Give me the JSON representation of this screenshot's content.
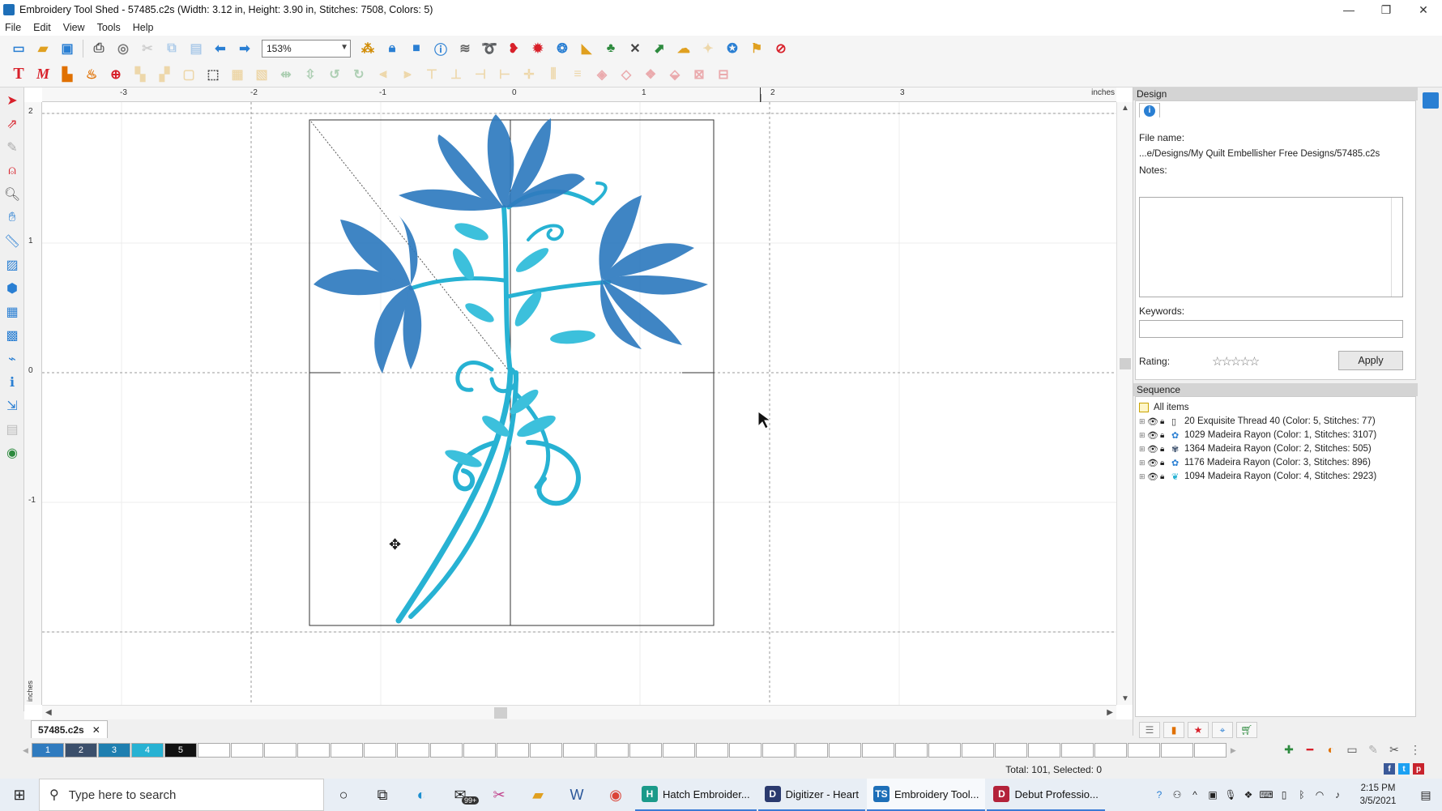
{
  "window": {
    "title": "Embroidery Tool Shed - 57485.c2s (Width: 3.12 in, Height: 3.90 in, Stitches: 7508, Colors: 5)",
    "minimize": "—",
    "restore": "❐",
    "close": "✕"
  },
  "menu": [
    "File",
    "Edit",
    "View",
    "Tools",
    "Help"
  ],
  "toolbar": {
    "zoom_value": "153%",
    "zoom_options": [
      "153%"
    ]
  },
  "ruler": {
    "units": "inches",
    "h_labels": [
      "-3",
      "-2",
      "-1",
      "0",
      "1",
      "2",
      "3"
    ],
    "v_labels": [
      "2",
      "1",
      "0",
      "-1"
    ],
    "v_units": "inches"
  },
  "document_tab": {
    "name": "57485.c2s",
    "close": "✕"
  },
  "color_swatches": [
    {
      "label": "1",
      "color": "#2f7bbf"
    },
    {
      "label": "2",
      "color": "#3b4f6b"
    },
    {
      "label": "3",
      "color": "#1f7fb0"
    },
    {
      "label": "4",
      "color": "#27b2d3"
    },
    {
      "label": "5",
      "color": "#111111"
    }
  ],
  "status": {
    "text": "Total: 101, Selected: 0"
  },
  "panel": {
    "design_header": "Design",
    "file_name_label": "File name:",
    "file_name_value": "...e/Designs/My Quilt Embellisher Free Designs/57485.c2s",
    "notes_label": "Notes:",
    "notes_value": "",
    "keywords_label": "Keywords:",
    "keywords_value": "",
    "rating_label": "Rating:",
    "rating_stars": "☆☆☆☆☆",
    "apply_label": "Apply",
    "sequence_header": "Sequence",
    "all_items": "All items",
    "sequence_items": [
      "20 Exquisite Thread 40 (Color: 5, Stitches: 77)",
      "1029 Madeira Rayon (Color: 1, Stitches: 3107)",
      "1364 Madeira Rayon (Color: 2, Stitches: 505)",
      "1176 Madeira Rayon (Color: 3, Stitches: 896)",
      "1094 Madeira Rayon (Color: 4, Stitches: 2923)"
    ]
  },
  "taskbar": {
    "search_placeholder": "Type here to search",
    "mail_badge": "99+",
    "apps": [
      {
        "label": "Hatch Embroider...",
        "color": "#1b9a8a",
        "letter": "H"
      },
      {
        "label": "Digitizer - Heart",
        "color": "#2b3a6e",
        "letter": "D"
      },
      {
        "label": "Embroidery Tool...",
        "color": "#1e6fb8",
        "letter": "TS"
      },
      {
        "label": "Debut Professio...",
        "color": "#b3223a",
        "letter": "D"
      }
    ],
    "time": "2:15 PM",
    "date": "3/5/2021"
  },
  "colors": {
    "dark_blue_thread": "#2f7bbf",
    "light_blue_thread": "#27b2d3",
    "accent": "#2a7fd3"
  }
}
